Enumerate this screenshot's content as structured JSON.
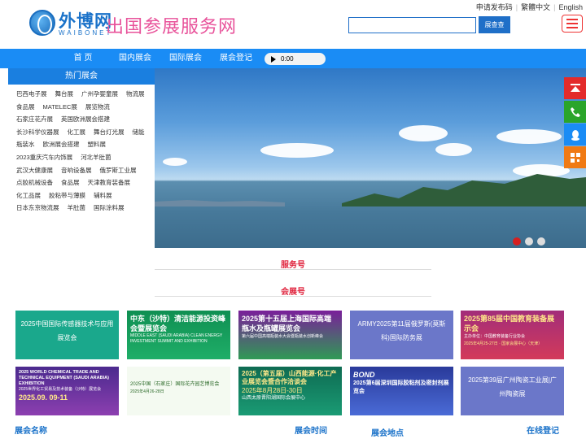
{
  "top_links": [
    "申请发布码",
    "繁體中文",
    "English"
  ],
  "logo": {
    "cn": "外博网",
    "en": "WAIBONET"
  },
  "site_title": "出国参展服务网",
  "search": {
    "value": "",
    "button": "展查查"
  },
  "nav": {
    "items": [
      "首 页",
      "国内展会",
      "国际展会",
      "展会登记"
    ],
    "audio_time": "0:00"
  },
  "hot": {
    "title": "热门展会",
    "items": [
      "巴西电子展",
      "舞台展",
      "广州孕婴童展",
      "物流展",
      "食品展",
      "MATELEC展",
      "展览物流",
      "石家庄花卉展",
      "英国欧洲展会搭建",
      "长沙科学仪器展",
      "化工展",
      "舞台灯光展",
      "储能",
      "瓶装水",
      "欧洲展会搭建",
      "塑料展",
      "2023重庆汽车内饰展",
      "河北羊肚菌",
      "武汉大健康展",
      "音响设备展",
      "俄罗斯工业展",
      "点胶机械设备",
      "食品展",
      "天津教育装备展",
      "化工品展",
      "胶粘带与薄膜",
      "辅料展",
      "日本东京物流展",
      "羊肚菌",
      "国际涂料展"
    ]
  },
  "sections": {
    "service_no": "服务号",
    "exhibition_no": "会展号"
  },
  "cards": {
    "c1": "2025中国国际传感器技术与应用展览会",
    "c2_title": "中东（沙特）清洁能源投资峰会暨展览会",
    "c2_sub": "MIDDLE EAST (SAUDI ARABIA) CLEAN ENERGY INVESTMENT SUMMIT AND EXHIBITION",
    "c3_title": "2025第十五届上海国际高端瓶水及瓶罐展览会",
    "c3_sub": "第六届中国高端瓶装水大会暨瓶装水创新峰会",
    "c4": "ARMY2025第11届俄罗斯(莫斯科)国际防务展",
    "c5_title": "2025第85届中国教育装备展示会",
    "c5_sub": "主办单位：中国教育装备行业协会",
    "c5_date": "2025年4月25-27日 · 国家会展中心（天津）",
    "c6_title": "2025 WORLD CHEMICAL TRADE AND TECHNICAL EQUIPMENT (SAUDI ARABIA) EXHIBITION",
    "c6_cn": "2025世界化工贸易及技术装备（沙特）展览会",
    "c6_date": "2025.09. 09-11",
    "c7_title": "2025中国（石家庄）国际花卉园艺博览会",
    "c7_date": "2025年4月26-28日",
    "c8_title": "2025（第五届）山西能源·化工产业展览会暨合作洽谈会",
    "c8_date": "2025年8月28日-30日",
    "c8_place": "山西太原晋阳湖国际会展中心",
    "c9_logo": "BOND",
    "c9_title": "2025第6届深圳国际胶粘剂及密封剂展览会",
    "c10": "2025第39届广州陶瓷工业展|广州陶瓷展"
  },
  "bottom": [
    "展会名称",
    "展会时间",
    "展会地点",
    "在线登记"
  ],
  "colors": {
    "nav": "#1a8cf5",
    "accent_pink": "#e8529a",
    "section_red": "#e0263f"
  }
}
